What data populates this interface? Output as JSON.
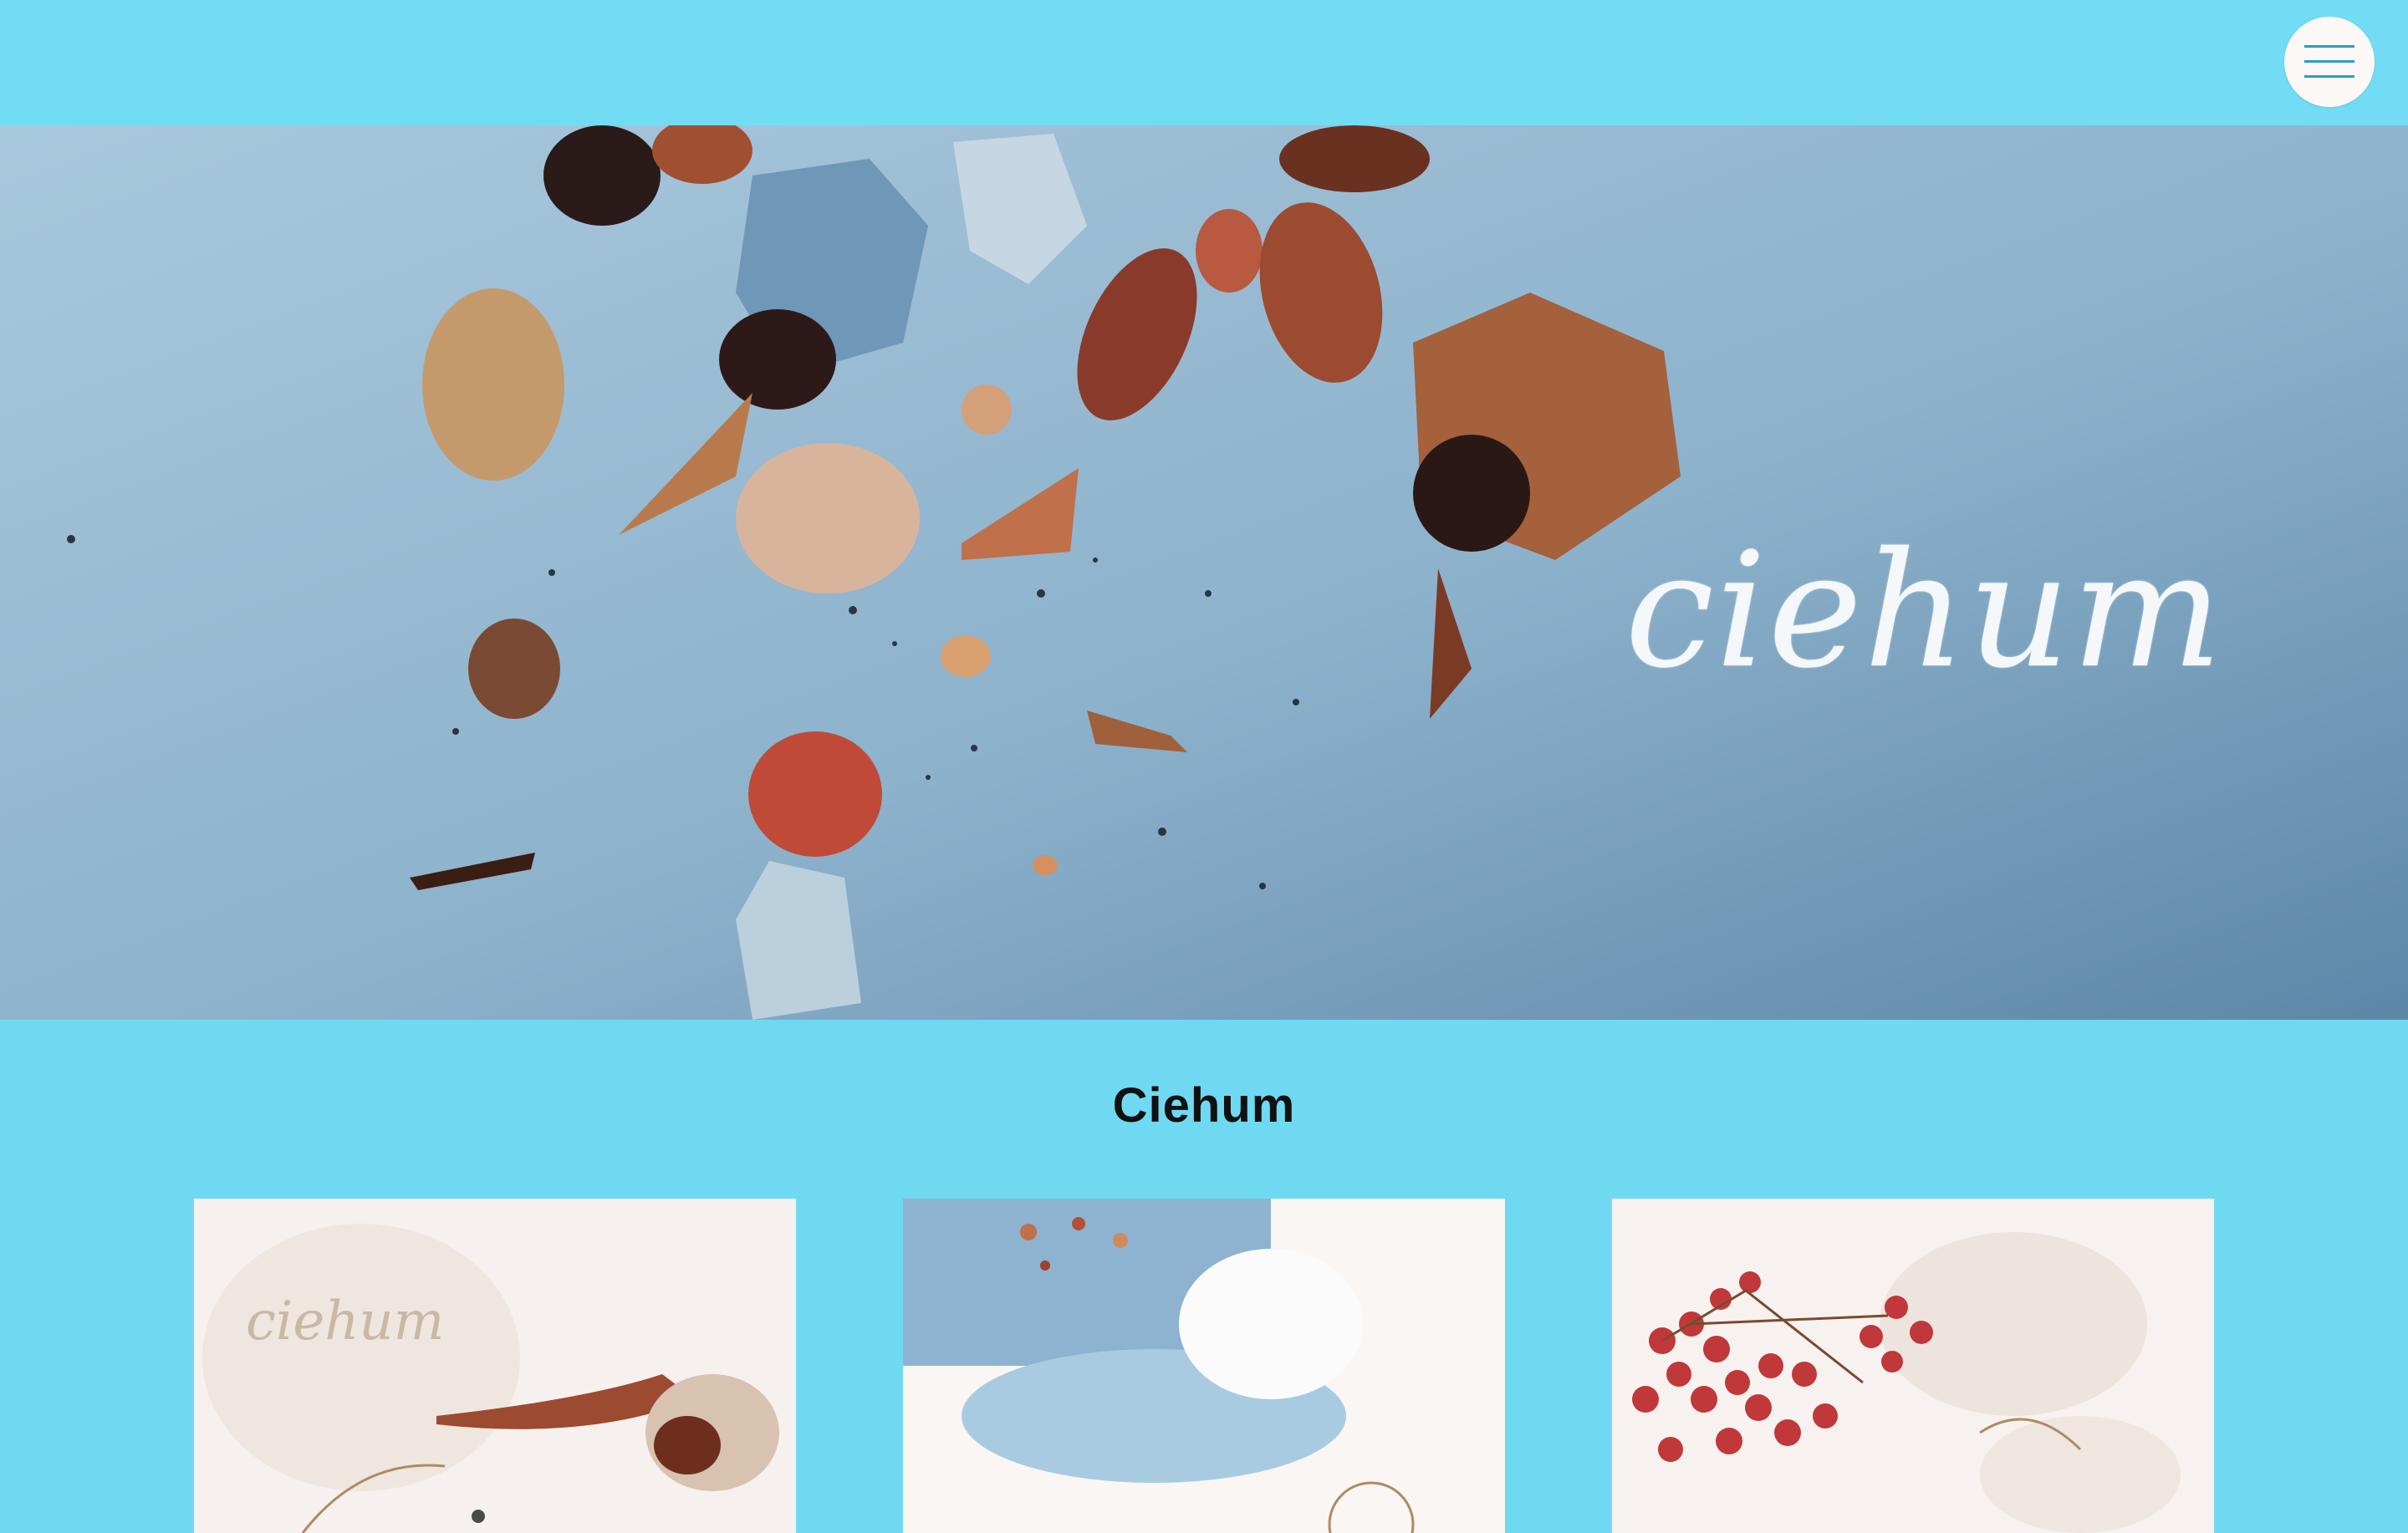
{
  "header": {
    "menu_icon": "hamburger-menu-icon"
  },
  "hero": {
    "logo_text": "ciehum"
  },
  "main": {
    "title": "Ciehum"
  },
  "cards": [
    {
      "logo_text": "ciehum",
      "image": "seashell earrings photo"
    },
    {
      "image": "shell dish with hoop earrings photo"
    },
    {
      "image": "red berries and coral photo"
    }
  ],
  "colors": {
    "background": "#6fd9f2",
    "menu_button": "#fbf8f6",
    "hero_sky": "#8fb4cf",
    "title_text": "#111111"
  }
}
